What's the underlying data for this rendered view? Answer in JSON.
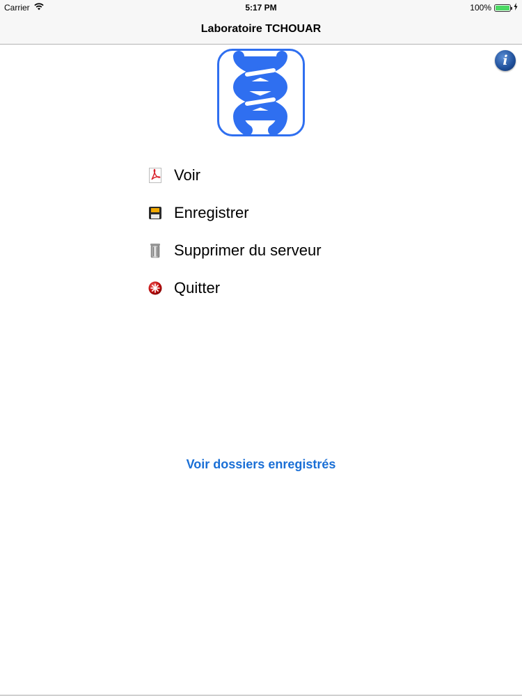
{
  "status_bar": {
    "carrier": "Carrier",
    "time": "5:17 PM",
    "battery": "100%"
  },
  "nav": {
    "title": "Laboratoire TCHOUAR"
  },
  "menu": {
    "items": [
      {
        "label": "Voir",
        "icon": "pdf-icon"
      },
      {
        "label": "Enregistrer",
        "icon": "save-icon"
      },
      {
        "label": "Supprimer du serveur",
        "icon": "trash-icon"
      },
      {
        "label": "Quitter",
        "icon": "quit-icon"
      }
    ]
  },
  "links": {
    "saved_folders": "Voir dossiers enregistrés"
  },
  "info_button": {
    "glyph": "i"
  },
  "colors": {
    "accent": "#1a6fd6",
    "logo_blue": "#2f6ff0"
  }
}
